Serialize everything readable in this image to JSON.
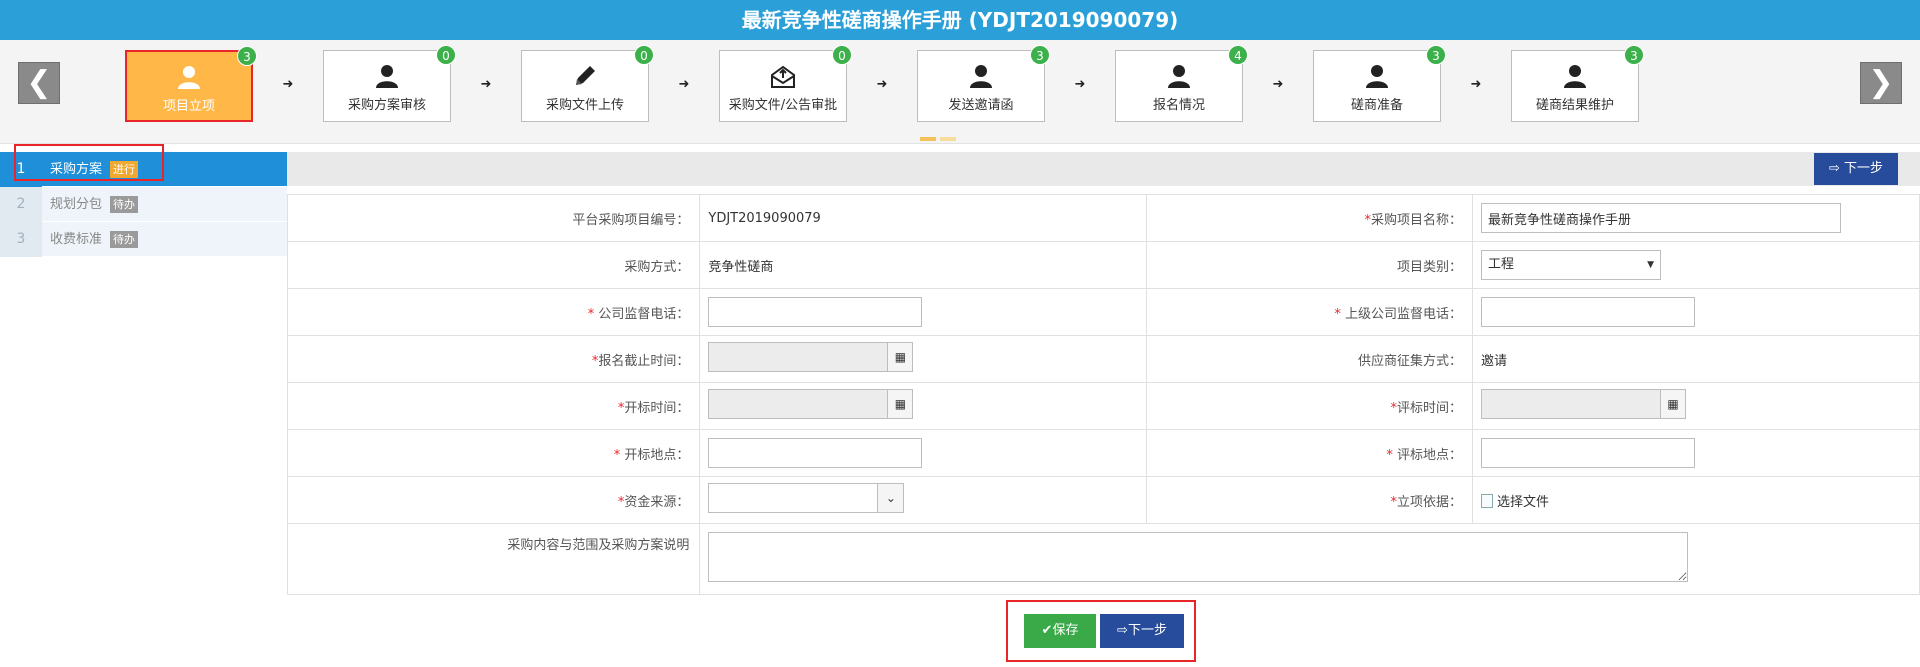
{
  "window": {
    "title": "最新竞争性磋商操作手册 (YDJT2019090079)"
  },
  "nav": {
    "prev_icon": "chevron-left-icon",
    "next_icon": "chevron-right-icon",
    "prev_glyph": "❮",
    "next_glyph": "❯"
  },
  "steps": [
    {
      "label": "项目立项",
      "count": "3",
      "icon": "user-icon",
      "active": true
    },
    {
      "label": "采购方案审核",
      "count": "0",
      "icon": "user-icon"
    },
    {
      "label": "采购文件上传",
      "count": "0",
      "icon": "pencil-icon"
    },
    {
      "label": "采购文件/公告审批",
      "count": "0",
      "icon": "envelope-upload-icon"
    },
    {
      "label": "发送邀请函",
      "count": "3",
      "icon": "user-icon"
    },
    {
      "label": "报名情况",
      "count": "4",
      "icon": "user-icon"
    },
    {
      "label": "磋商准备",
      "count": "3",
      "icon": "user-icon"
    },
    {
      "label": "磋商结果维护",
      "count": "3",
      "icon": "user-icon"
    }
  ],
  "step_arrow_glyph": "➜",
  "sidebar": {
    "items": [
      {
        "num": "1",
        "label": "采购方案",
        "tag": "进行",
        "active": true
      },
      {
        "num": "2",
        "label": "规划分包",
        "tag": "待办"
      },
      {
        "num": "3",
        "label": "收费标准",
        "tag": "待办"
      }
    ]
  },
  "toolbar": {
    "next_label": "下一步"
  },
  "form": {
    "platform_no_label": "平台采购项目编号：",
    "platform_no_value": "YDJT2019090079",
    "project_name_label": "采购项目名称：",
    "project_name_value": "最新竞争性磋商操作手册",
    "method_label": "采购方式：",
    "method_value": "竞争性磋商",
    "category_label": "项目类别：",
    "category_value": "工程",
    "supervise_phone_label": "公司监督电话：",
    "upper_phone_label": "上级公司监督电话：",
    "deadline_label": "报名截止时间：",
    "supplier_method_label": "供应商征集方式：",
    "supplier_method_value": "邀请",
    "open_time_label": "开标时间：",
    "eval_time_label": "评标时间：",
    "open_place_label": "开标地点：",
    "eval_place_label": "评标地点：",
    "fund_label": "资金来源：",
    "basis_label": "立项依据：",
    "basis_file_label": "选择文件",
    "content_label": "采购内容与范围及采购方案说明",
    "required_mark": "*",
    "calendar_glyph": "▦",
    "caret_glyph": "▼",
    "combo_glyph": "⌄"
  },
  "footer": {
    "save_label": "保存",
    "next_label": "下一步",
    "save_icon": "check-icon",
    "next_icon": "circle-arrow-icon"
  }
}
